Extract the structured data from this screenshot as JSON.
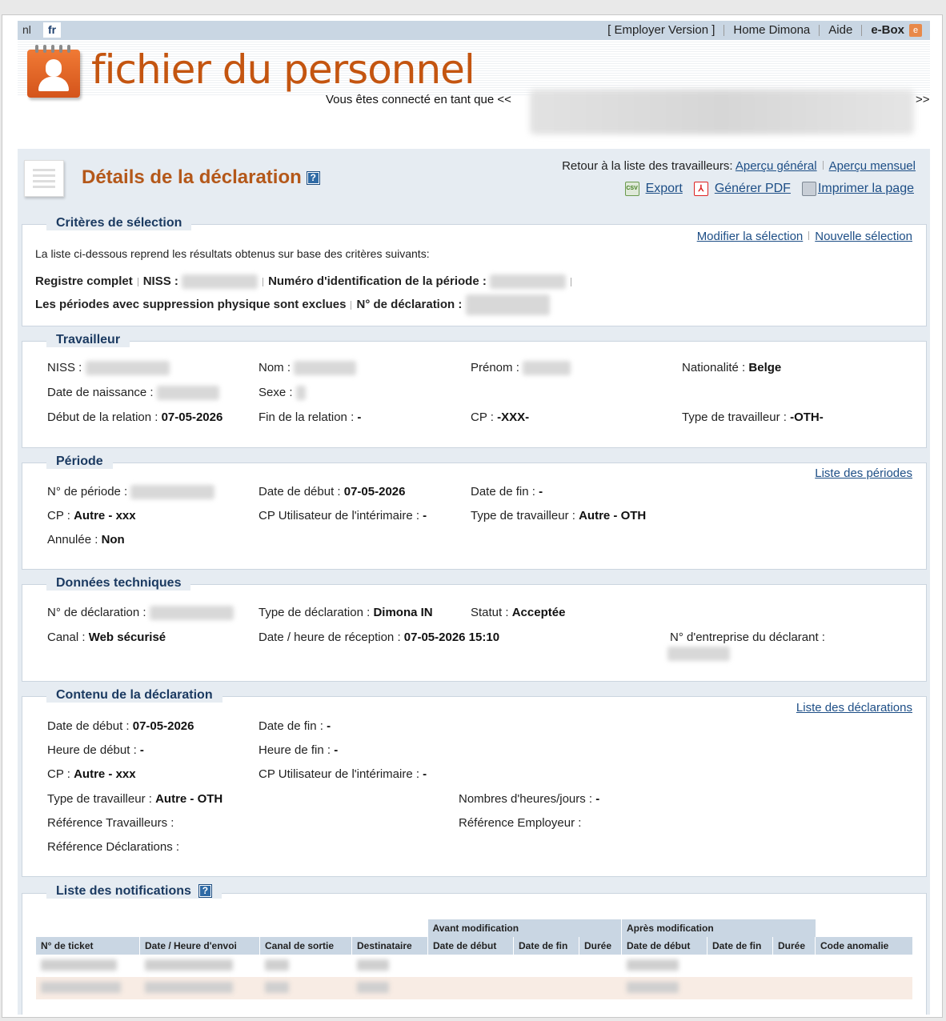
{
  "topbar": {
    "lang_nl": "nl",
    "lang_fr": "fr",
    "links": [
      "[ Employer Version ]",
      "Home Dimona",
      "Aide",
      "e-Box"
    ]
  },
  "banner": {
    "app_title": "fichier du personnel",
    "connected_prefix": "Vous êtes connecté en tant que <<",
    "connected_suffix": ">>"
  },
  "page": {
    "title": "Détails de la déclaration",
    "help": "?",
    "retour_label": "Retour à la liste des travailleurs:",
    "apercu_general": "Aperçu général",
    "apercu_mensuel": "Aperçu mensuel",
    "export": "Export",
    "generer_pdf": "Générer PDF",
    "imprimer": "Imprimer la page"
  },
  "criteres": {
    "title": "Critères de sélection",
    "modifier": "Modifier la sélection",
    "nouvelle": "Nouvelle sélection",
    "intro": "La liste ci-dessous reprend les résultats obtenus sur base des critères suivants:",
    "registre": "Registre complet",
    "niss_label": "NISS :",
    "numero_periode_label": "Numéro d'identification de la période :",
    "exclues": "Les périodes avec suppression physique sont exclues",
    "num_declaration_label": "N° de déclaration :"
  },
  "travailleur": {
    "title": "Travailleur",
    "niss_label": "NISS : ",
    "nom_label": "Nom : ",
    "prenom_label": "Prénom : ",
    "nationalite_label": "Nationalité : ",
    "nationalite": "Belge",
    "naissance_label": "Date de naissance : ",
    "sexe_label": "Sexe : ",
    "debut_label": "Début de la relation : ",
    "debut": "07-05-2026",
    "fin_label": "Fin de la relation : ",
    "fin": "-",
    "cp_label": "CP : ",
    "cp": "-XXX-",
    "type_label": "Type de travailleur : ",
    "type": "-OTH-"
  },
  "periode": {
    "title": "Période",
    "liste": "Liste des périodes",
    "num_label": "N° de période : ",
    "debut_label": "Date de début : ",
    "debut": "07-05-2026",
    "fin_label": "Date de fin : ",
    "fin": "-",
    "cp_label": "CP : ",
    "cp": "Autre - xxx",
    "cp_util_label": "CP Utilisateur de l'intérimaire : ",
    "cp_util": "-",
    "type_label": "Type de travailleur : ",
    "type": "Autre - OTH",
    "annulee_label": "Annulée : ",
    "annulee": "Non"
  },
  "techniques": {
    "title": "Données techniques",
    "num_label": "N° de déclaration : ",
    "type_label": "Type de déclaration : ",
    "type": "Dimona IN",
    "statut_label": "Statut : ",
    "statut": "Acceptée",
    "canal_label": "Canal : ",
    "canal": "Web sécurisé",
    "reception_label": "Date / heure de réception : ",
    "reception": "07-05-2026 15:10",
    "entreprise_label": "N° d'entreprise du déclarant :"
  },
  "contenu": {
    "title": "Contenu de la déclaration",
    "liste": "Liste des déclarations",
    "debut_label": "Date de début : ",
    "debut": "07-05-2026",
    "fin_label": "Date de fin : ",
    "fin": "-",
    "hdebut_label": "Heure de début : ",
    "hdebut": "-",
    "hfin_label": "Heure de fin : ",
    "hfin": "-",
    "cp_label": "CP : ",
    "cp": "Autre - xxx",
    "cp_util_label": "CP Utilisateur de l'intérimaire : ",
    "cp_util": "-",
    "type_label": "Type de travailleur : ",
    "type": "Autre - OTH",
    "heures_label": "Nombres d'heures/jours : ",
    "heures": "-",
    "ref_trav": "Référence  Travailleurs :",
    "ref_empl": "Référence  Employeur :",
    "ref_decl": "Référence  Déclarations :"
  },
  "notifications": {
    "title": "Liste des notifications",
    "avant": "Avant modification",
    "apres": "Après modification",
    "columns": [
      "N° de ticket",
      "Date / Heure d'envoi",
      "Canal de sortie",
      "Destinataire",
      "Date de début",
      "Date de fin",
      "Durée",
      "Date de début",
      "Date de fin",
      "Durée",
      "Code anomalie"
    ]
  }
}
